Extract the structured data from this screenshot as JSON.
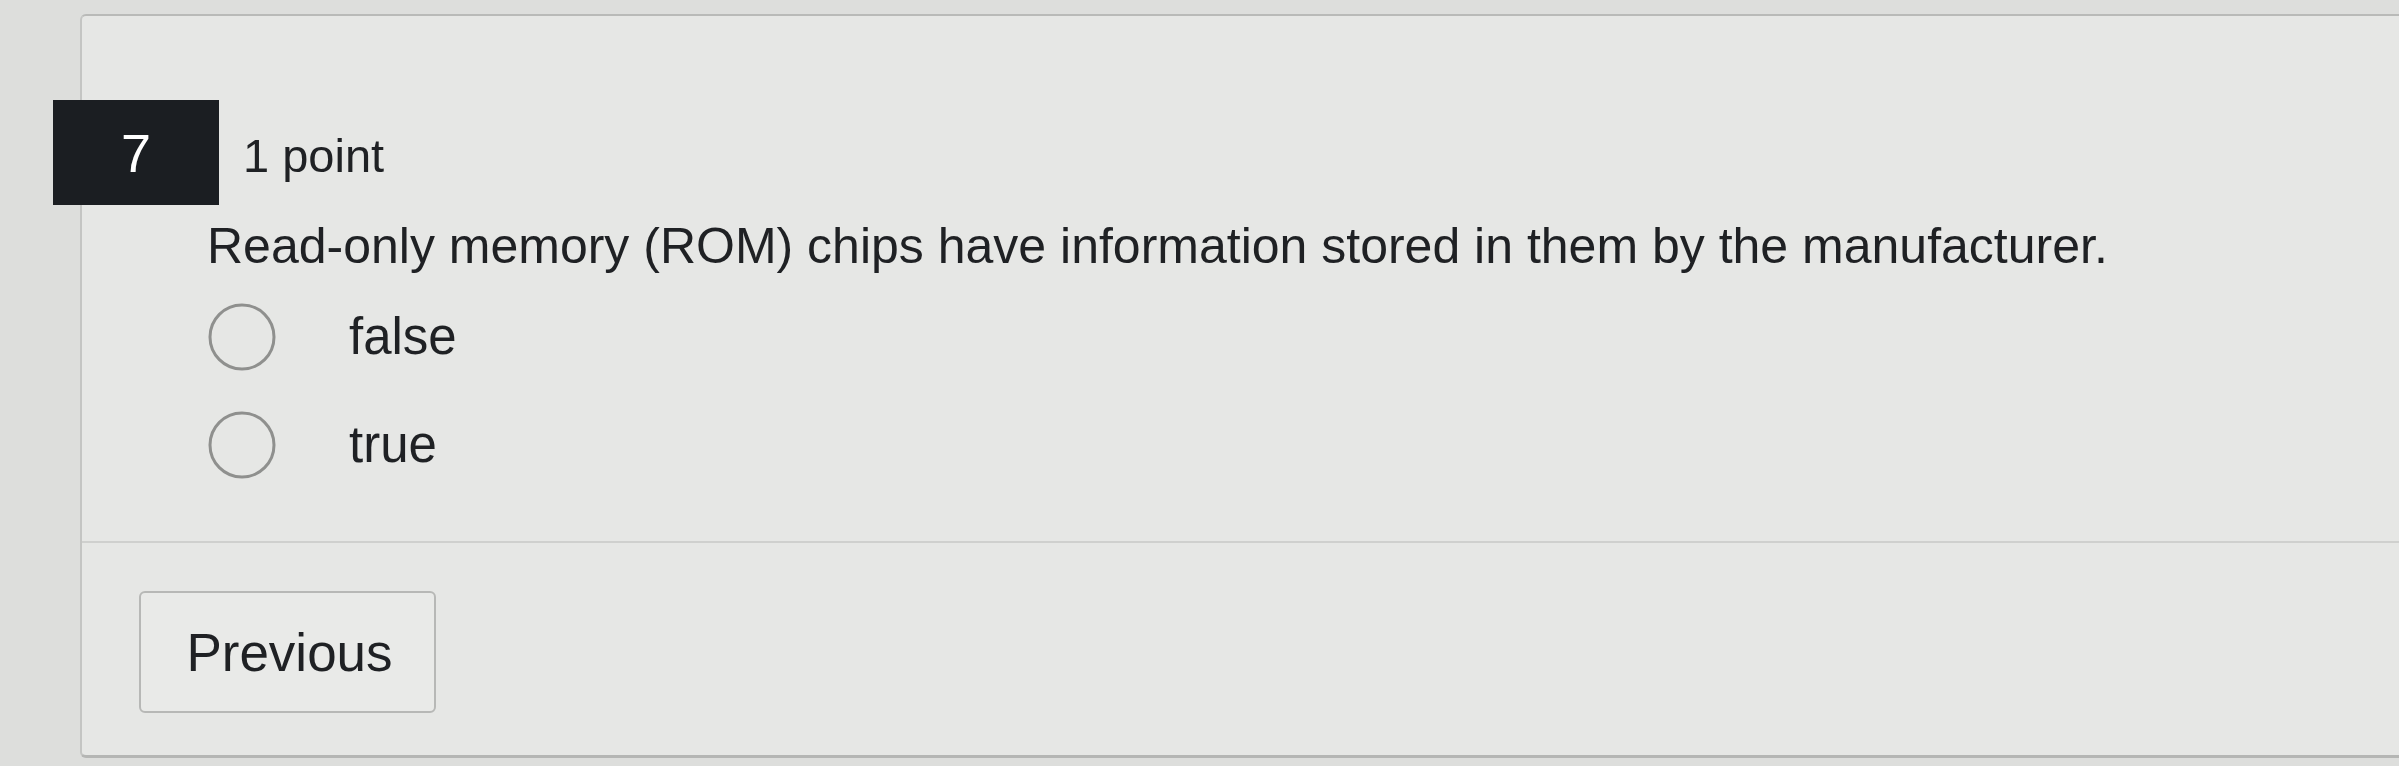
{
  "question": {
    "number": "7",
    "points": "1 point",
    "text": "Read-only memory (ROM) chips have information stored in them by the manufacturer.",
    "options": [
      {
        "label": "false",
        "selected": false
      },
      {
        "label": "true",
        "selected": false
      }
    ]
  },
  "buttons": [
    {
      "label": "Previous"
    }
  ]
}
